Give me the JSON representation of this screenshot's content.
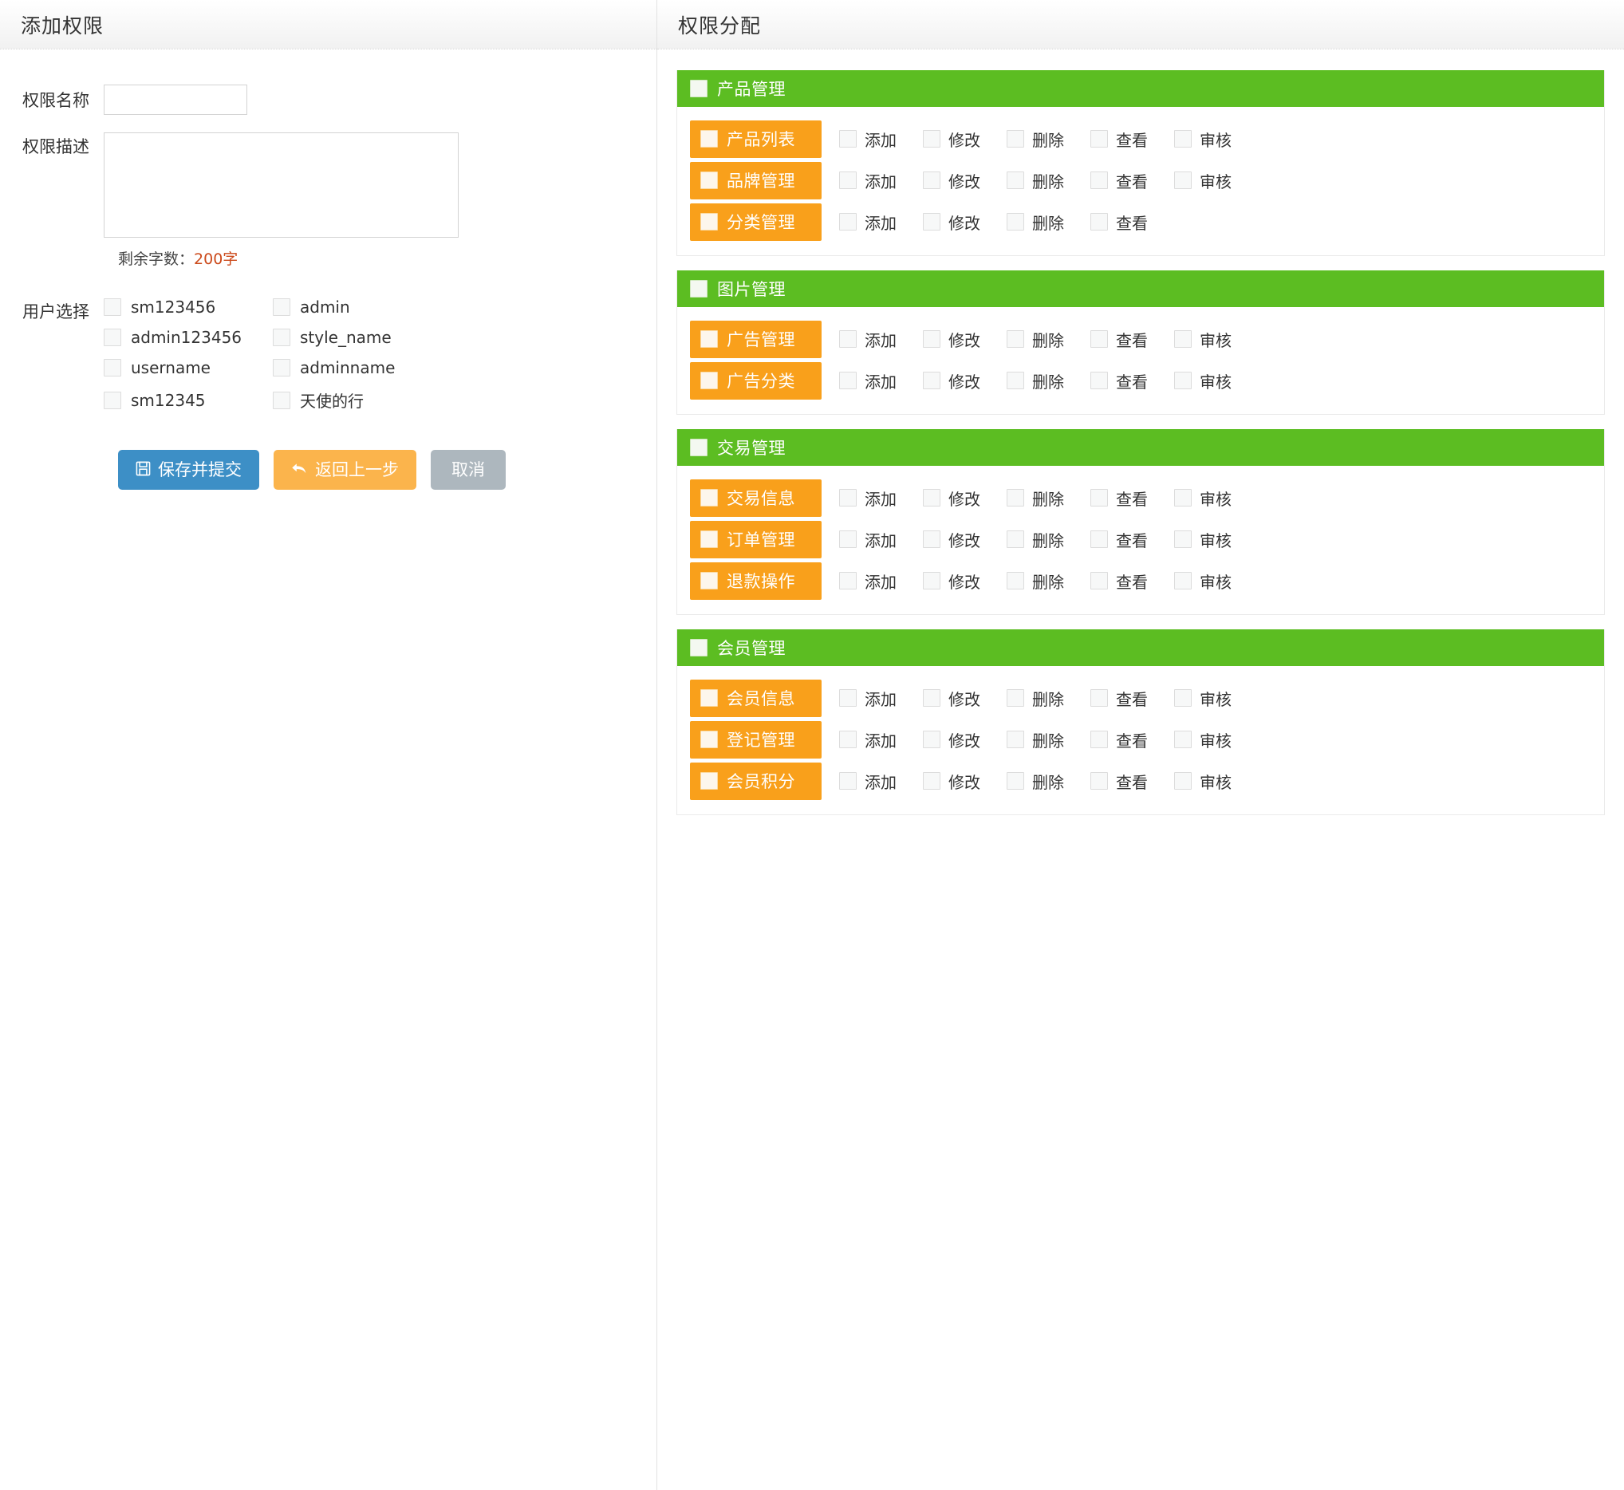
{
  "left": {
    "header_title": "添加权限",
    "fields": {
      "name_label": "权限名称",
      "name_value": "",
      "name_placeholder": "",
      "desc_label": "权限描述",
      "desc_value": "",
      "desc_placeholder": "",
      "counter_prefix": "剩余字数：",
      "counter_value": "200字",
      "counter_color": "#cc4a1b"
    },
    "users_label": "用户选择",
    "users": [
      {
        "name": "sm123456",
        "checked": false
      },
      {
        "name": "admin",
        "checked": false
      },
      {
        "name": "admin123456",
        "checked": false
      },
      {
        "name": "style_name",
        "checked": false
      },
      {
        "name": "username",
        "checked": false
      },
      {
        "name": "adminname",
        "checked": false
      },
      {
        "name": "sm12345",
        "checked": false
      },
      {
        "name": "天使的行",
        "checked": false
      }
    ],
    "buttons": [
      {
        "label": "保存并提交",
        "icon": "save-icon",
        "glyph": "ὋE",
        "color": "#3d8fc6",
        "name": "save-and-submit-button"
      },
      {
        "label": "返回上一步",
        "icon": "back-arrow-icon",
        "glyph": "↩",
        "color": "#fbb44c",
        "name": "back-button"
      },
      {
        "label": "取消",
        "icon": "",
        "glyph": "",
        "color": "#adb7be",
        "name": "cancel-button"
      }
    ]
  },
  "right": {
    "header_title": "权限分配",
    "colors": {
      "section_green": "#5cbd22",
      "module_orange": "#f9a01b"
    },
    "sections": [
      {
        "title": "产品管理",
        "checked": false,
        "modules": [
          {
            "name": "产品列表",
            "checked": false,
            "actions": [
              "添加",
              "修改",
              "删除",
              "查看",
              "审核"
            ]
          },
          {
            "name": "品牌管理",
            "checked": false,
            "actions": [
              "添加",
              "修改",
              "删除",
              "查看",
              "审核"
            ]
          },
          {
            "name": "分类管理",
            "checked": false,
            "actions": [
              "添加",
              "修改",
              "删除",
              "查看"
            ]
          }
        ]
      },
      {
        "title": "图片管理",
        "checked": false,
        "modules": [
          {
            "name": "广告管理",
            "checked": false,
            "actions": [
              "添加",
              "修改",
              "删除",
              "查看",
              "审核"
            ]
          },
          {
            "name": "广告分类",
            "checked": false,
            "actions": [
              "添加",
              "修改",
              "删除",
              "查看",
              "审核"
            ]
          }
        ]
      },
      {
        "title": "交易管理",
        "checked": false,
        "modules": [
          {
            "name": "交易信息",
            "checked": false,
            "actions": [
              "添加",
              "修改",
              "删除",
              "查看",
              "审核"
            ]
          },
          {
            "name": "订单管理",
            "checked": false,
            "actions": [
              "添加",
              "修改",
              "删除",
              "查看",
              "审核"
            ]
          },
          {
            "name": "退款操作",
            "checked": false,
            "actions": [
              "添加",
              "修改",
              "删除",
              "查看",
              "审核"
            ]
          }
        ]
      },
      {
        "title": "会员管理",
        "checked": false,
        "modules": [
          {
            "name": "会员信息",
            "checked": false,
            "actions": [
              "添加",
              "修改",
              "删除",
              "查看",
              "审核"
            ]
          },
          {
            "name": "登记管理",
            "checked": false,
            "actions": [
              "添加",
              "修改",
              "删除",
              "查看",
              "审核"
            ]
          },
          {
            "name": "会员积分",
            "checked": false,
            "actions": [
              "添加",
              "修改",
              "删除",
              "查看",
              "审核"
            ]
          }
        ]
      }
    ]
  }
}
